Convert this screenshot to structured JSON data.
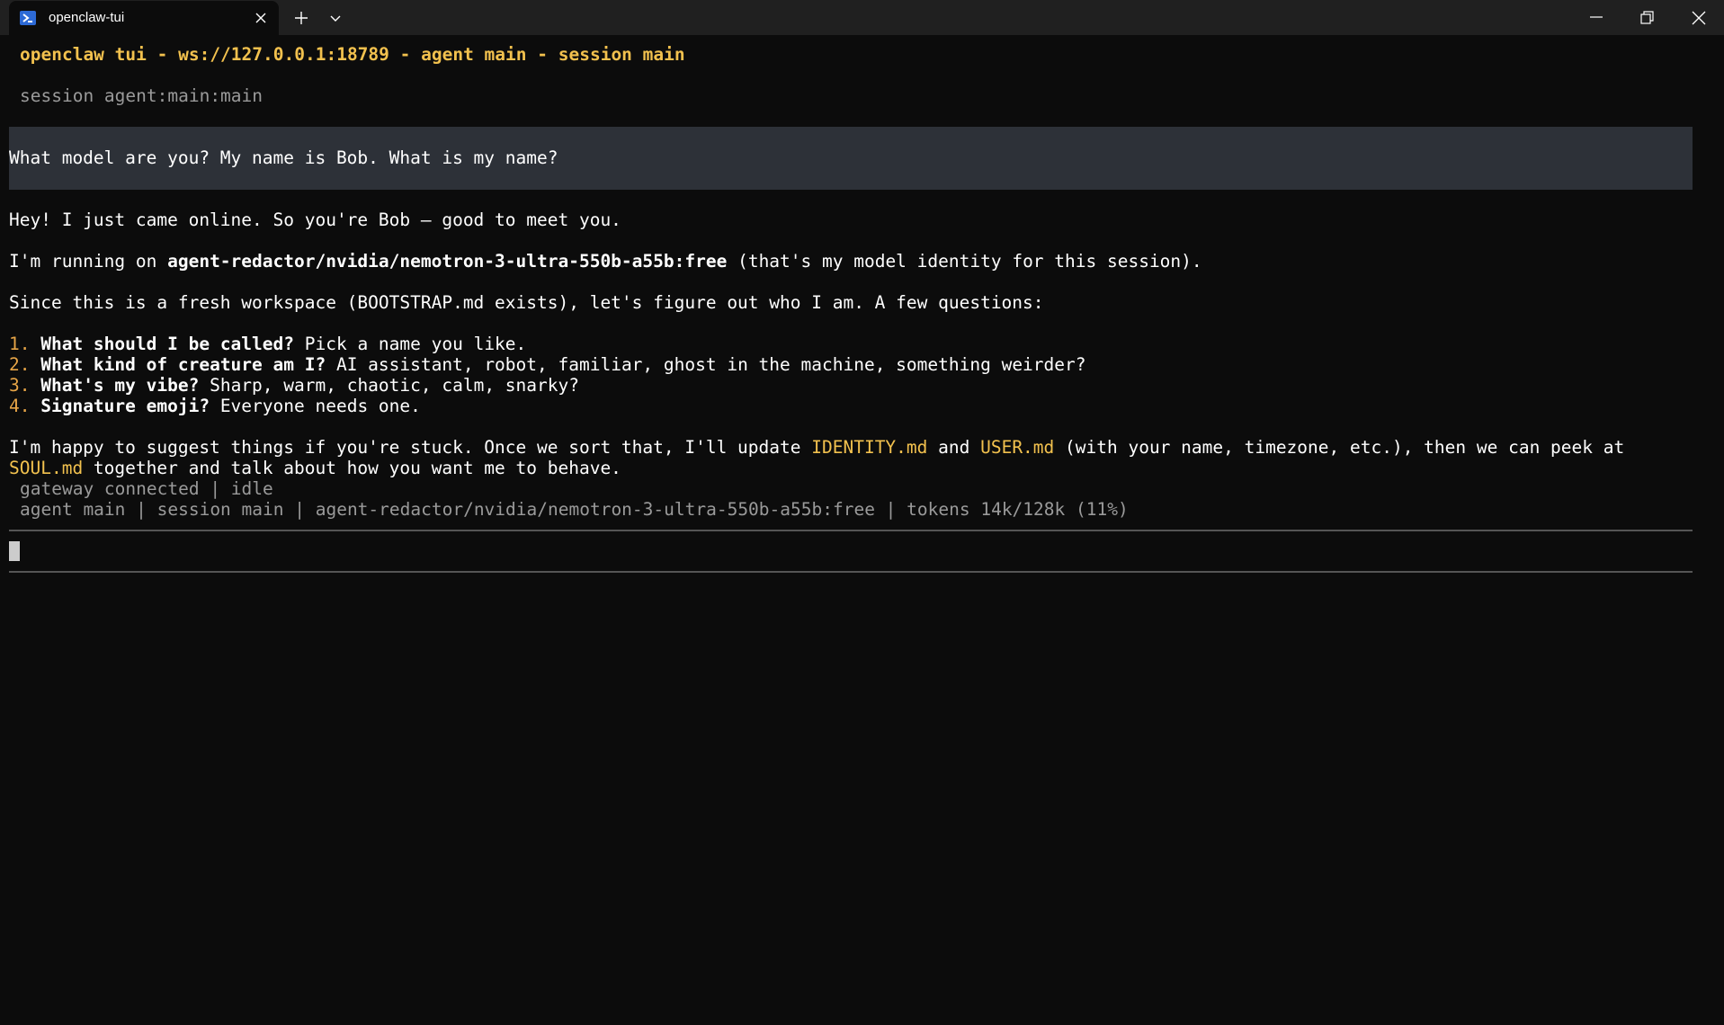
{
  "window": {
    "tab_title": "openclaw-tui",
    "icons": {
      "tab_icon": "powershell-icon",
      "tab_close": "close-icon",
      "new_tab": "plus-icon",
      "dropdown": "chevron-down-icon",
      "minimize": "minimize-icon",
      "maximize": "restore-icon",
      "close": "close-icon"
    }
  },
  "header": {
    "title_line": "openclaw tui - ws://127.0.0.1:18789 - agent main - session main",
    "session_line": "session agent:main:main"
  },
  "user_message": "What model are you? My name is Bob. What is my name?",
  "assistant": {
    "greeting": "Hey! I just came online. So you're Bob — good to meet you.",
    "running_prefix": "I'm running on ",
    "model_id": "agent-redactor/nvidia/nemotron-3-ultra-550b-a55b:free",
    "running_suffix": " (that's my model identity for this session).",
    "bootstrap_line": "Since this is a fresh workspace (BOOTSTRAP.md exists), let's figure out who I am. A few questions:",
    "questions": [
      {
        "num": "1. ",
        "q": "What should I be called?",
        "rest": " Pick a name you like."
      },
      {
        "num": "2. ",
        "q": "What kind of creature am I?",
        "rest": " AI assistant, robot, familiar, ghost in the machine, something weirder?"
      },
      {
        "num": "3. ",
        "q": "What's my vibe?",
        "rest": " Sharp, warm, chaotic, calm, snarky?"
      },
      {
        "num": "4. ",
        "q": "Signature emoji?",
        "rest": " Everyone needs one."
      }
    ],
    "closing_a": "I'm happy to suggest things if you're stuck. Once we sort that, I'll update ",
    "file_identity": "IDENTITY.md",
    "closing_and": " and ",
    "file_user": "USER.md",
    "closing_b": " (with your name, timezone, etc.), then we can peek at",
    "file_soul": "SOUL.md",
    "closing_c": " together and talk about how you want me to behave."
  },
  "status": {
    "connection": "gateway connected | idle",
    "footer": "agent main | session main | agent-redactor/nvidia/nemotron-3-ultra-550b-a55b:free | tokens 14k/128k (11%)"
  },
  "colors": {
    "background": "#0c0c0c",
    "titlebar": "#202020",
    "accent_yellow": "#f2c14e",
    "list_number": "#e7a547",
    "user_message_bg": "#2d3138",
    "dim_text": "#9a9a9a"
  },
  "input": {
    "value": ""
  }
}
